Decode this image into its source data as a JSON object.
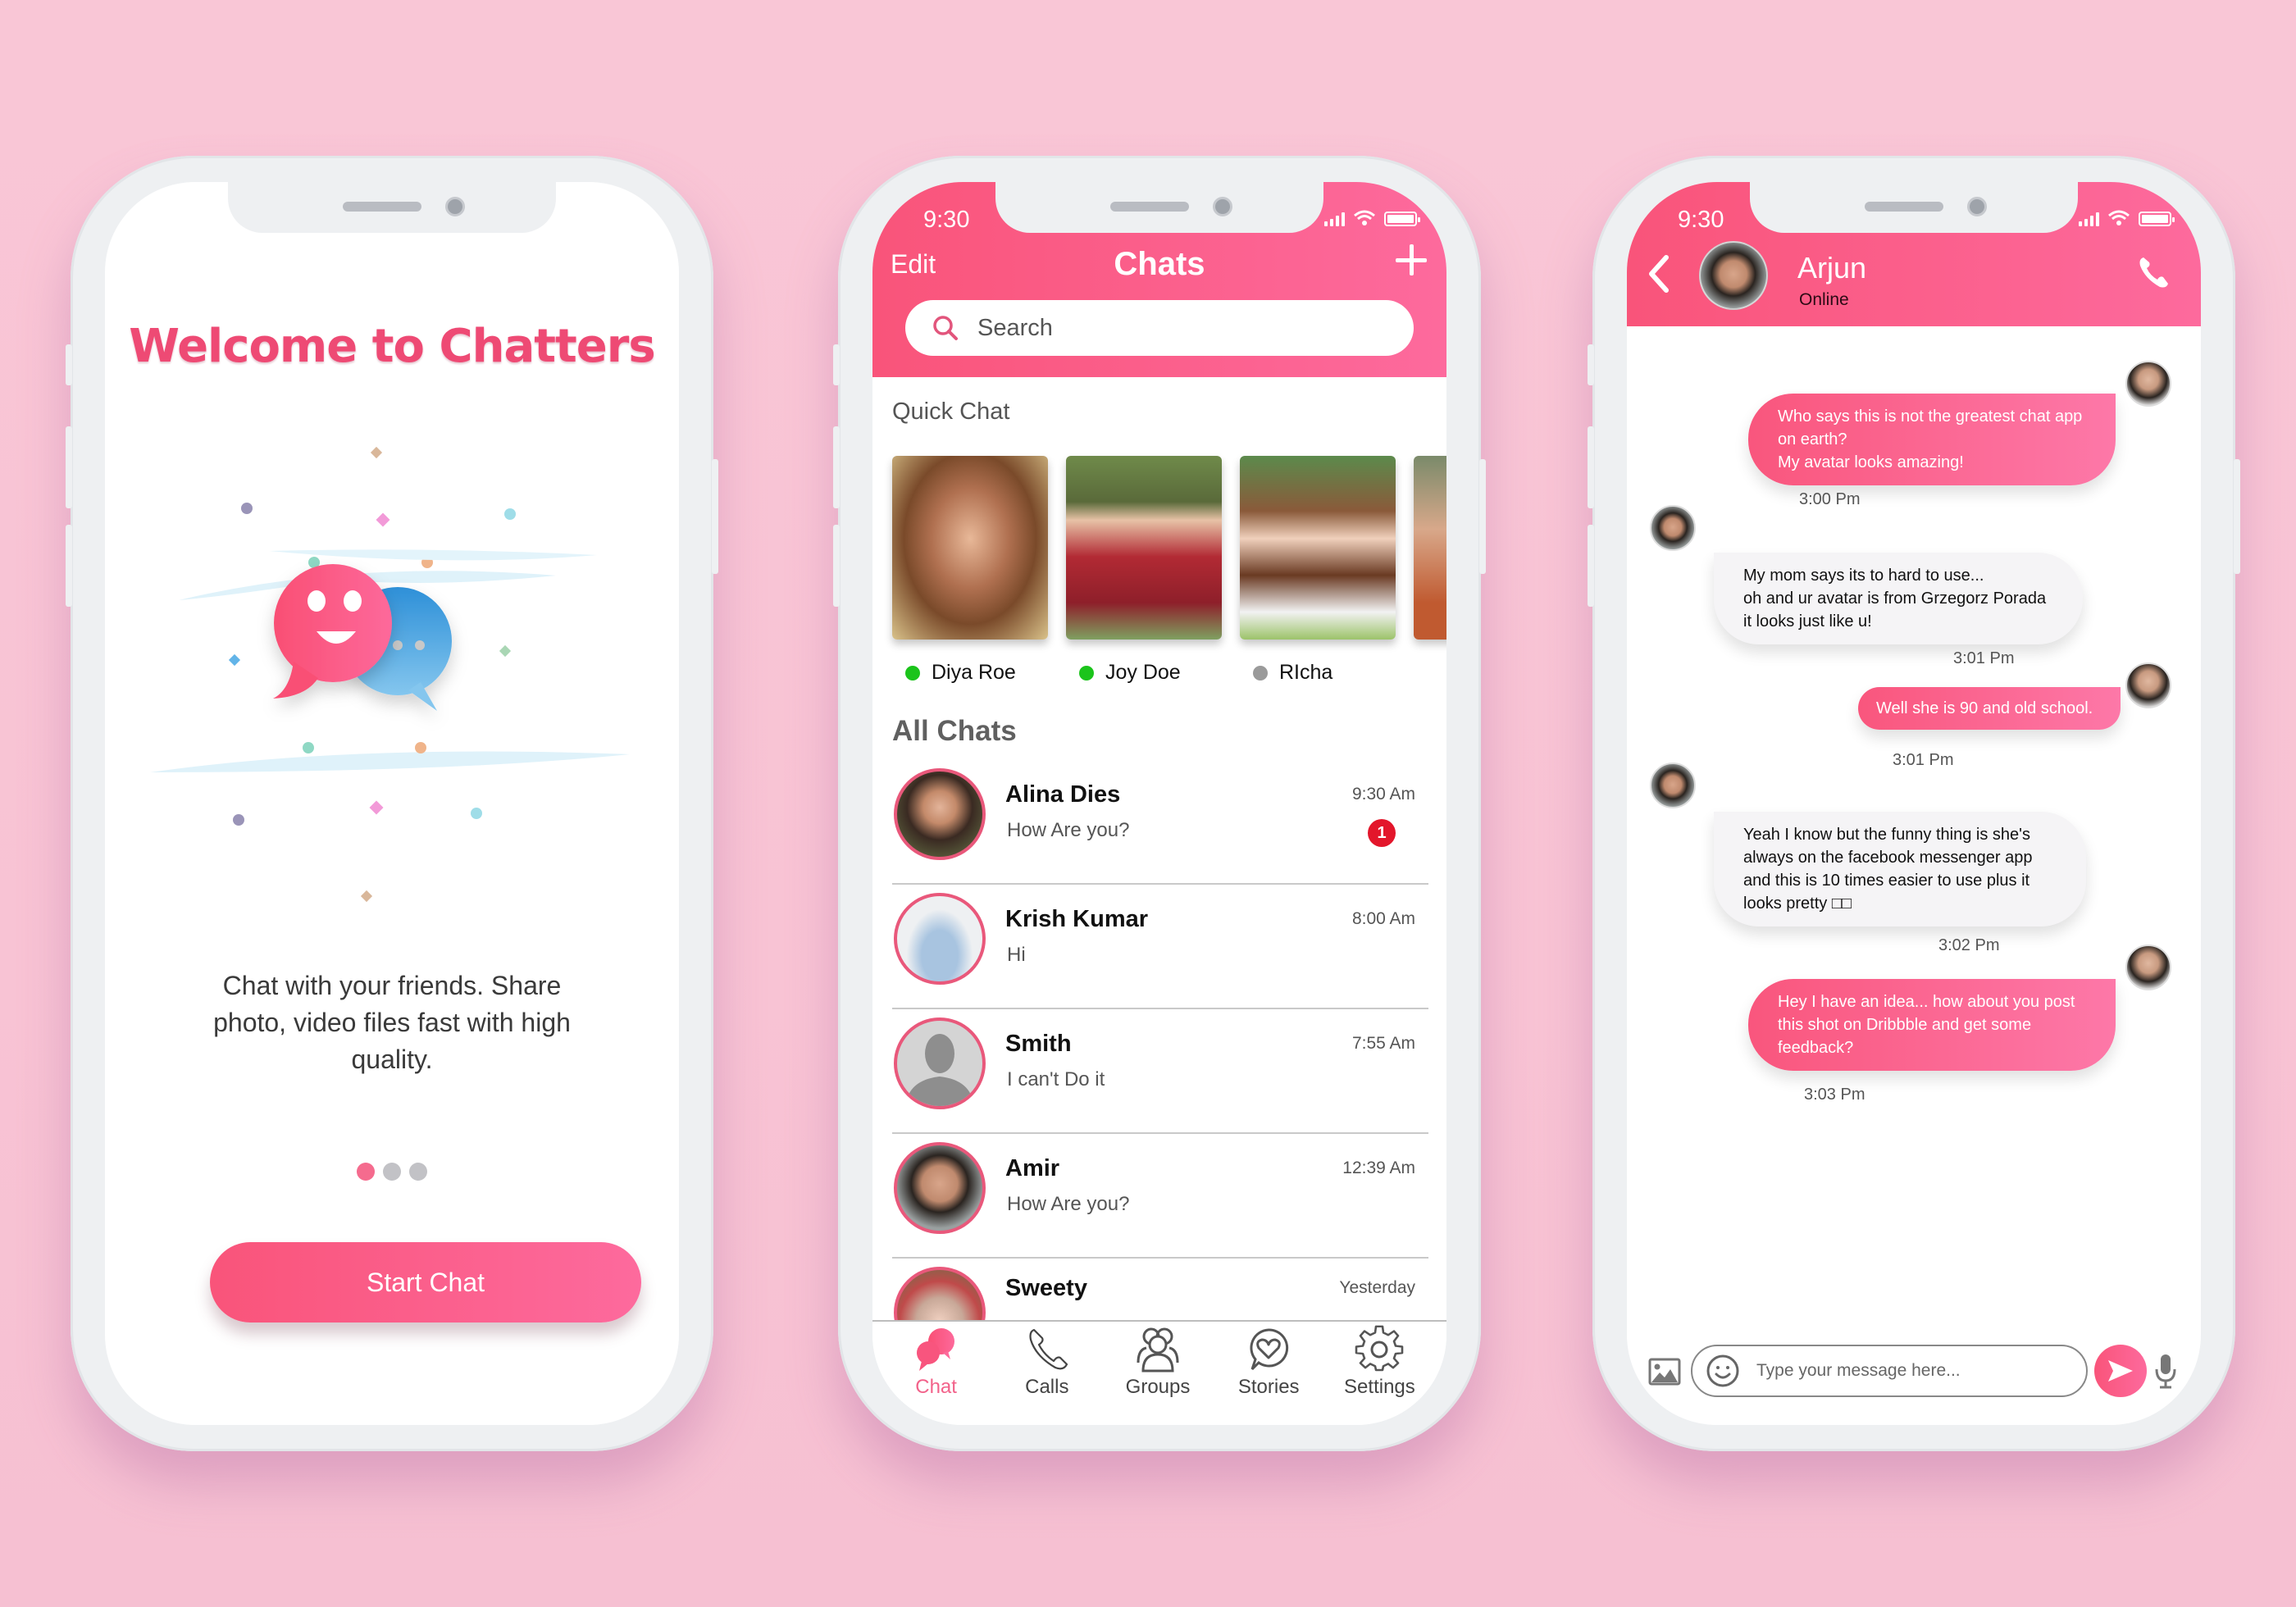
{
  "colors": {
    "brand_pink": "#f9547a",
    "brand_pink_light": "#fd6a9d",
    "online_green": "#1bc41b",
    "offline_gray": "#9a9a9a",
    "unread_red": "#e3162b",
    "background": "#f8c3d4"
  },
  "welcome_screen": {
    "title": "Welcome to Chatters",
    "illustration": "chat-bubbles-smiley-illustration",
    "description": "Chat with your friends. Share photo, video files fast with high quality.",
    "pager": {
      "count": 3,
      "active_index": 0
    },
    "start_button_label": "Start Chat"
  },
  "chats_screen": {
    "status_bar": {
      "time": "9:30",
      "icons": [
        "signal-icon",
        "wifi-icon",
        "battery-icon"
      ]
    },
    "header": {
      "edit_label": "Edit",
      "title": "Chats",
      "add_icon": "plus-icon"
    },
    "search": {
      "placeholder": "Search",
      "icon": "search-icon"
    },
    "quick_chat": {
      "label": "Quick Chat",
      "contacts": [
        {
          "name": "Diya Roe",
          "status": "online"
        },
        {
          "name": "Joy Doe",
          "status": "online"
        },
        {
          "name": "RIcha",
          "status": "offline"
        },
        {
          "name": "",
          "status": ""
        }
      ]
    },
    "all_chats": {
      "label": "All Chats",
      "items": [
        {
          "name": "Alina Dies",
          "message": "How Are you?",
          "time": "9:30 Am",
          "unread": "1"
        },
        {
          "name": "Krish Kumar",
          "message": "Hi",
          "time": "8:00 Am",
          "unread": ""
        },
        {
          "name": "Smith",
          "message": "I  can't Do it",
          "time": "7:55 Am",
          "unread": ""
        },
        {
          "name": "Amir",
          "message": "How Are you?",
          "time": "12:39 Am",
          "unread": ""
        },
        {
          "name": "Sweety",
          "message": "",
          "time": "Yesterday",
          "unread": ""
        }
      ]
    },
    "tabs": [
      {
        "label": "Chat",
        "icon": "chat-bubbles-icon",
        "active": true
      },
      {
        "label": "Calls",
        "icon": "phone-icon",
        "active": false
      },
      {
        "label": "Groups",
        "icon": "group-icon",
        "active": false
      },
      {
        "label": "Stories",
        "icon": "heart-bubble-icon",
        "active": false
      },
      {
        "label": "Settings",
        "icon": "gear-icon",
        "active": false
      }
    ]
  },
  "conversation_screen": {
    "status_bar": {
      "time": "9:30"
    },
    "contact": {
      "name": "Arjun",
      "status": "Online"
    },
    "messages": [
      {
        "direction": "out",
        "lines": [
          "Who says this is not the greatest chat app",
          "on earth?",
          "My avatar looks amazing!"
        ],
        "time": "3:00 Pm"
      },
      {
        "direction": "in",
        "lines": [
          "My mom says its to hard to use...",
          "oh and ur avatar is from Grzegorz Porada",
          "it looks just like u!"
        ],
        "time": "3:01 Pm"
      },
      {
        "direction": "out",
        "lines": [
          "Well she is 90 and old school."
        ],
        "time": "3:01 Pm"
      },
      {
        "direction": "in",
        "lines": [
          "Yeah I know but the funny thing is she's",
          "always on the facebook messenger app",
          "and this is 10 times  easier to use plus it",
          "looks pretty □□"
        ],
        "time": "3:02 Pm"
      },
      {
        "direction": "out",
        "lines": [
          "Hey I have an idea... how about you post",
          "this shot on Dribbble    and get some",
          "feedback?"
        ],
        "time": "3:03 Pm"
      }
    ],
    "composer": {
      "placeholder": "Type your message here..."
    }
  }
}
